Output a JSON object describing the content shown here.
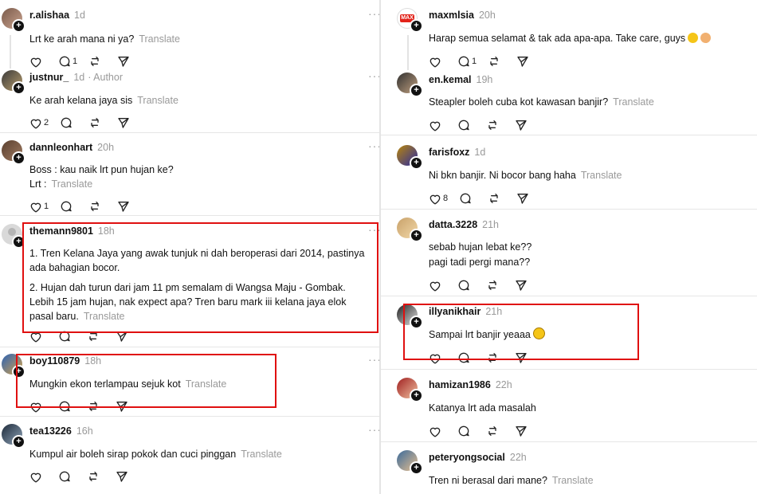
{
  "left_comments": [
    {
      "username": "r.alishaa",
      "time": "1d",
      "lines": [
        "Lrt ke arah mana ni ya?"
      ],
      "translate": "Translate",
      "like_count": "",
      "reply_count": "1"
    },
    {
      "username": "justnur_",
      "time": "1d",
      "author_tag": "· Author",
      "lines": [
        "Ke arah kelana jaya sis"
      ],
      "translate": "Translate",
      "like_count": "2",
      "reply_count": ""
    },
    {
      "username": "dannleonhart",
      "time": "20h",
      "lines": [
        "Boss : kau naik lrt pun hujan ke?",
        "Lrt :"
      ],
      "translate": "Translate",
      "like_count": "1",
      "reply_count": ""
    },
    {
      "username": "themann9801",
      "time": "18h",
      "lines": [
        "1. Tren Kelana Jaya yang awak tunjuk ni dah beroperasi dari 2014, pastinya ada bahagian bocor.",
        "2. Hujan dah turun dari jam 11 pm semalam di Wangsa Maju - Gombak. Lebih 15 jam hujan, nak expect apa? Tren baru mark iii kelana jaya elok pasal baru."
      ],
      "translate": "Translate",
      "like_count": "",
      "reply_count": ""
    },
    {
      "username": "boy110879",
      "time": "18h",
      "lines": [
        "Mungkin ekon terlampau sejuk kot"
      ],
      "translate": "Translate",
      "like_count": "",
      "reply_count": ""
    },
    {
      "username": "tea13226",
      "time": "16h",
      "lines": [
        "Kumpul air boleh sirap pokok dan cuci pinggan"
      ],
      "translate": "Translate",
      "like_count": "",
      "reply_count": ""
    }
  ],
  "right_comments": [
    {
      "username": "maxmlsia",
      "time": "20h",
      "lines": [
        "Harap semua selamat & tak ada apa-apa. Take care, guys"
      ],
      "translate": "",
      "like_count": "",
      "reply_count": "1",
      "avatar_text": "MAX"
    },
    {
      "username": "en.kemal",
      "time": "19h",
      "lines": [
        "Steapler boleh cuba kot kawasan banjir?"
      ],
      "translate": "Translate",
      "like_count": "",
      "reply_count": ""
    },
    {
      "username": "farisfoxz",
      "time": "1d",
      "lines": [
        "Ni bkn banjir. Ni bocor bang haha"
      ],
      "translate": "Translate",
      "like_count": "8",
      "reply_count": ""
    },
    {
      "username": "datta.3228",
      "time": "21h",
      "lines": [
        "sebab hujan lebat ke??",
        "pagi tadi pergi mana??"
      ],
      "translate": "",
      "like_count": "",
      "reply_count": ""
    },
    {
      "username": "illyanikhair",
      "time": "21h",
      "lines": [
        "Sampai lrt banjir yeaaa"
      ],
      "translate": "",
      "like_count": "",
      "reply_count": ""
    },
    {
      "username": "hamizan1986",
      "time": "22h",
      "lines": [
        "Katanya lrt ada masalah"
      ],
      "translate": "",
      "like_count": "",
      "reply_count": ""
    },
    {
      "username": "peteryongsocial",
      "time": "22h",
      "lines": [
        "Tren ni berasal dari mane?"
      ],
      "translate": "Translate",
      "like_count": "",
      "reply_count": ""
    }
  ],
  "more_label": "···",
  "plus_label": "+",
  "colors": {
    "highlight": "#e01010",
    "muted": "#999999",
    "divider": "#e6e6e6",
    "text": "#111111"
  }
}
